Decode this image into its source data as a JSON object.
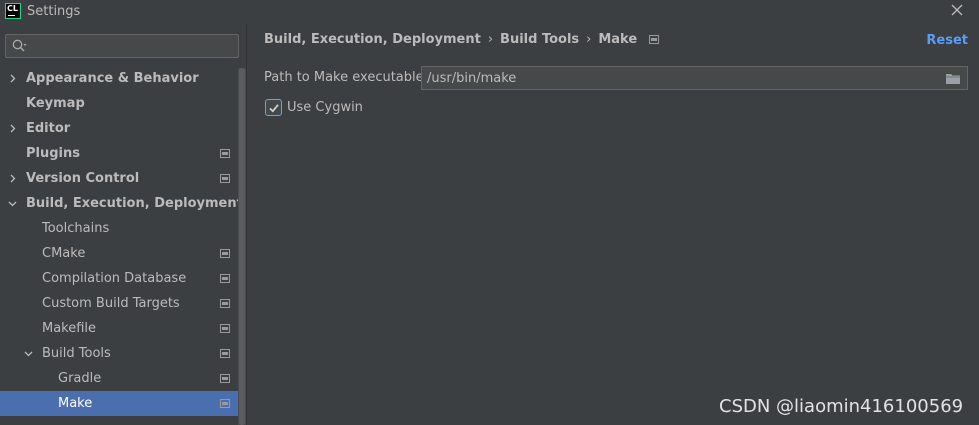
{
  "window": {
    "app_logo_text": "CL",
    "title": "Settings"
  },
  "search": {
    "value": "",
    "placeholder": ""
  },
  "sidebar": {
    "items": [
      {
        "label": "Appearance & Behavior",
        "level": 0,
        "arrow": "collapsed",
        "bold": true,
        "project_icon": false,
        "selected": false
      },
      {
        "label": "Keymap",
        "level": 0,
        "arrow": "none",
        "bold": true,
        "project_icon": false,
        "selected": false
      },
      {
        "label": "Editor",
        "level": 0,
        "arrow": "collapsed",
        "bold": true,
        "project_icon": false,
        "selected": false
      },
      {
        "label": "Plugins",
        "level": 0,
        "arrow": "none",
        "bold": true,
        "project_icon": true,
        "selected": false
      },
      {
        "label": "Version Control",
        "level": 0,
        "arrow": "collapsed",
        "bold": true,
        "project_icon": true,
        "selected": false
      },
      {
        "label": "Build, Execution, Deployment",
        "level": 0,
        "arrow": "expanded",
        "bold": true,
        "project_icon": false,
        "selected": false
      },
      {
        "label": "Toolchains",
        "level": 1,
        "arrow": "none",
        "bold": false,
        "project_icon": false,
        "selected": false
      },
      {
        "label": "CMake",
        "level": 1,
        "arrow": "none",
        "bold": false,
        "project_icon": true,
        "selected": false
      },
      {
        "label": "Compilation Database",
        "level": 1,
        "arrow": "none",
        "bold": false,
        "project_icon": true,
        "selected": false
      },
      {
        "label": "Custom Build Targets",
        "level": 1,
        "arrow": "none",
        "bold": false,
        "project_icon": true,
        "selected": false
      },
      {
        "label": "Makefile",
        "level": 1,
        "arrow": "none",
        "bold": false,
        "project_icon": true,
        "selected": false
      },
      {
        "label": "Build Tools",
        "level": 1,
        "arrow": "expanded",
        "bold": false,
        "project_icon": true,
        "selected": false
      },
      {
        "label": "Gradle",
        "level": 2,
        "arrow": "none",
        "bold": false,
        "project_icon": true,
        "selected": false
      },
      {
        "label": "Make",
        "level": 2,
        "arrow": "none",
        "bold": false,
        "project_icon": true,
        "selected": true
      }
    ]
  },
  "breadcrumb": {
    "items": [
      "Build, Execution, Deployment",
      "Build Tools",
      "Make"
    ],
    "separator": "›"
  },
  "reset_label": "Reset",
  "make_settings": {
    "path_label": "Path to Make executable",
    "path_value": "/usr/bin/make",
    "cygwin_label": "Use Cygwin",
    "cygwin_checked": true
  },
  "watermark": "CSDN @liaomin416100569",
  "colors": {
    "background": "#3c3f41",
    "selection": "#4b6eaf",
    "link": "#589df6",
    "text": "#bbbbbb"
  },
  "icons": {
    "search": "search-icon",
    "close": "close-icon",
    "folder": "folder-icon",
    "project_scope": "project-settings-icon",
    "tree_collapsed": "chevron-right-icon",
    "tree_expanded": "chevron-down-icon"
  }
}
